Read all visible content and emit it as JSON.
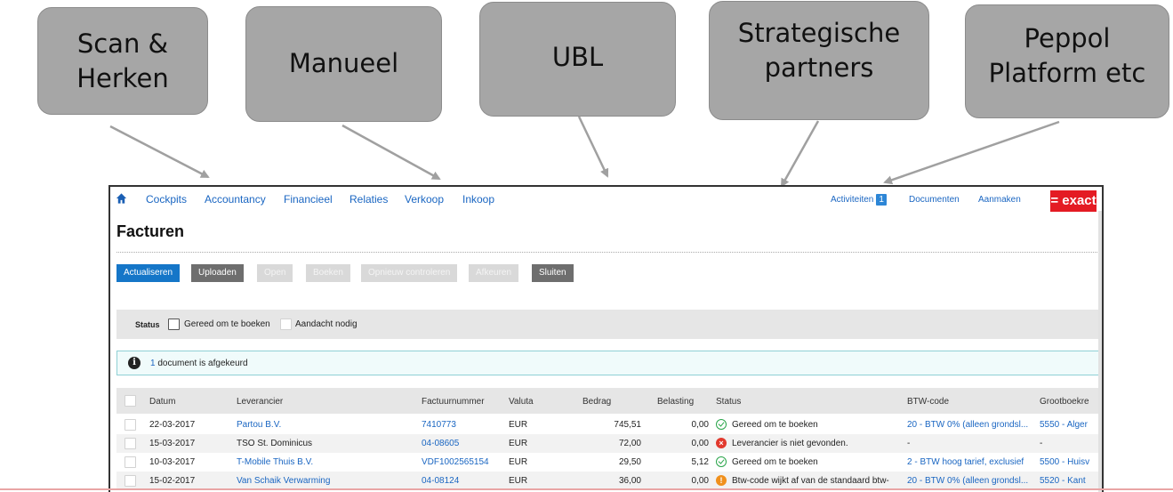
{
  "callouts": [
    {
      "line1": "Scan &",
      "line2": "Herken"
    },
    {
      "line1": "Manueel",
      "line2": ""
    },
    {
      "line1": "UBL",
      "line2": ""
    },
    {
      "line1": "Strategische",
      "line2": "partners"
    },
    {
      "line1": "Peppol",
      "line2": "Platform etc"
    }
  ],
  "nav": {
    "items": [
      "Cockpits",
      "Accountancy",
      "Financieel",
      "Relaties",
      "Verkoop",
      "Inkoop"
    ],
    "activiteiten": "Activiteiten",
    "activiteiten_count": "1",
    "documenten": "Documenten",
    "aanmaken": "Aanmaken",
    "brand": "= exact"
  },
  "page_title": "Facturen",
  "toolbar": {
    "actualiseren": "Actualiseren",
    "uploaden": "Uploaden",
    "open": "Open",
    "boeken": "Boeken",
    "opnieuw": "Opnieuw controleren",
    "afkeuren": "Afkeuren",
    "sluiten": "Sluiten"
  },
  "filter": {
    "label": "Status",
    "option1": "Gereed om te boeken",
    "option2": "Aandacht nodig"
  },
  "info": {
    "count": "1",
    "text": "document is afgekeurd"
  },
  "table": {
    "headers": {
      "datum": "Datum",
      "leverancier": "Leverancier",
      "factuurnummer": "Factuurnummer",
      "valuta": "Valuta",
      "bedrag": "Bedrag",
      "belasting": "Belasting",
      "status": "Status",
      "btw": "BTW-code",
      "grootboek": "Grootboekre"
    },
    "rows": [
      {
        "datum": "22-03-2017",
        "leverancier": "Partou B.V.",
        "factuur": "7410773",
        "valuta": "EUR",
        "bedrag": "745,51",
        "belasting": "0,00",
        "status": "Gereed om te boeken",
        "btw": "20 - BTW 0% (alleen grondsl...",
        "grootboek": "5550 - Alger"
      },
      {
        "datum": "15-03-2017",
        "leverancier": "TSO St. Dominicus",
        "factuur": "04-08605",
        "valuta": "EUR",
        "bedrag": "72,00",
        "belasting": "0,00",
        "status": "Leverancier is niet gevonden.",
        "btw": "-",
        "grootboek": "-"
      },
      {
        "datum": "10-03-2017",
        "leverancier": "T-Mobile Thuis B.V.",
        "factuur": "VDF1002565154",
        "valuta": "EUR",
        "bedrag": "29,50",
        "belasting": "5,12",
        "status": "Gereed om te boeken",
        "btw": "2 - BTW hoog tarief, exclusief",
        "grootboek": "5500 - Huisv"
      },
      {
        "datum": "15-02-2017",
        "leverancier": "Van Schaik Verwarming",
        "factuur": "04-08124",
        "valuta": "EUR",
        "bedrag": "36,00",
        "belasting": "0,00",
        "status": "Btw-code wijkt af van de standaard btw-",
        "btw": "20 - BTW 0% (alleen grondsl...",
        "grootboek": "5520 - Kant"
      }
    ]
  },
  "colors": {
    "callout": "#a6a6a6",
    "link": "#1a66c2",
    "brand": "#e41b23",
    "primary": "#1576c8"
  }
}
